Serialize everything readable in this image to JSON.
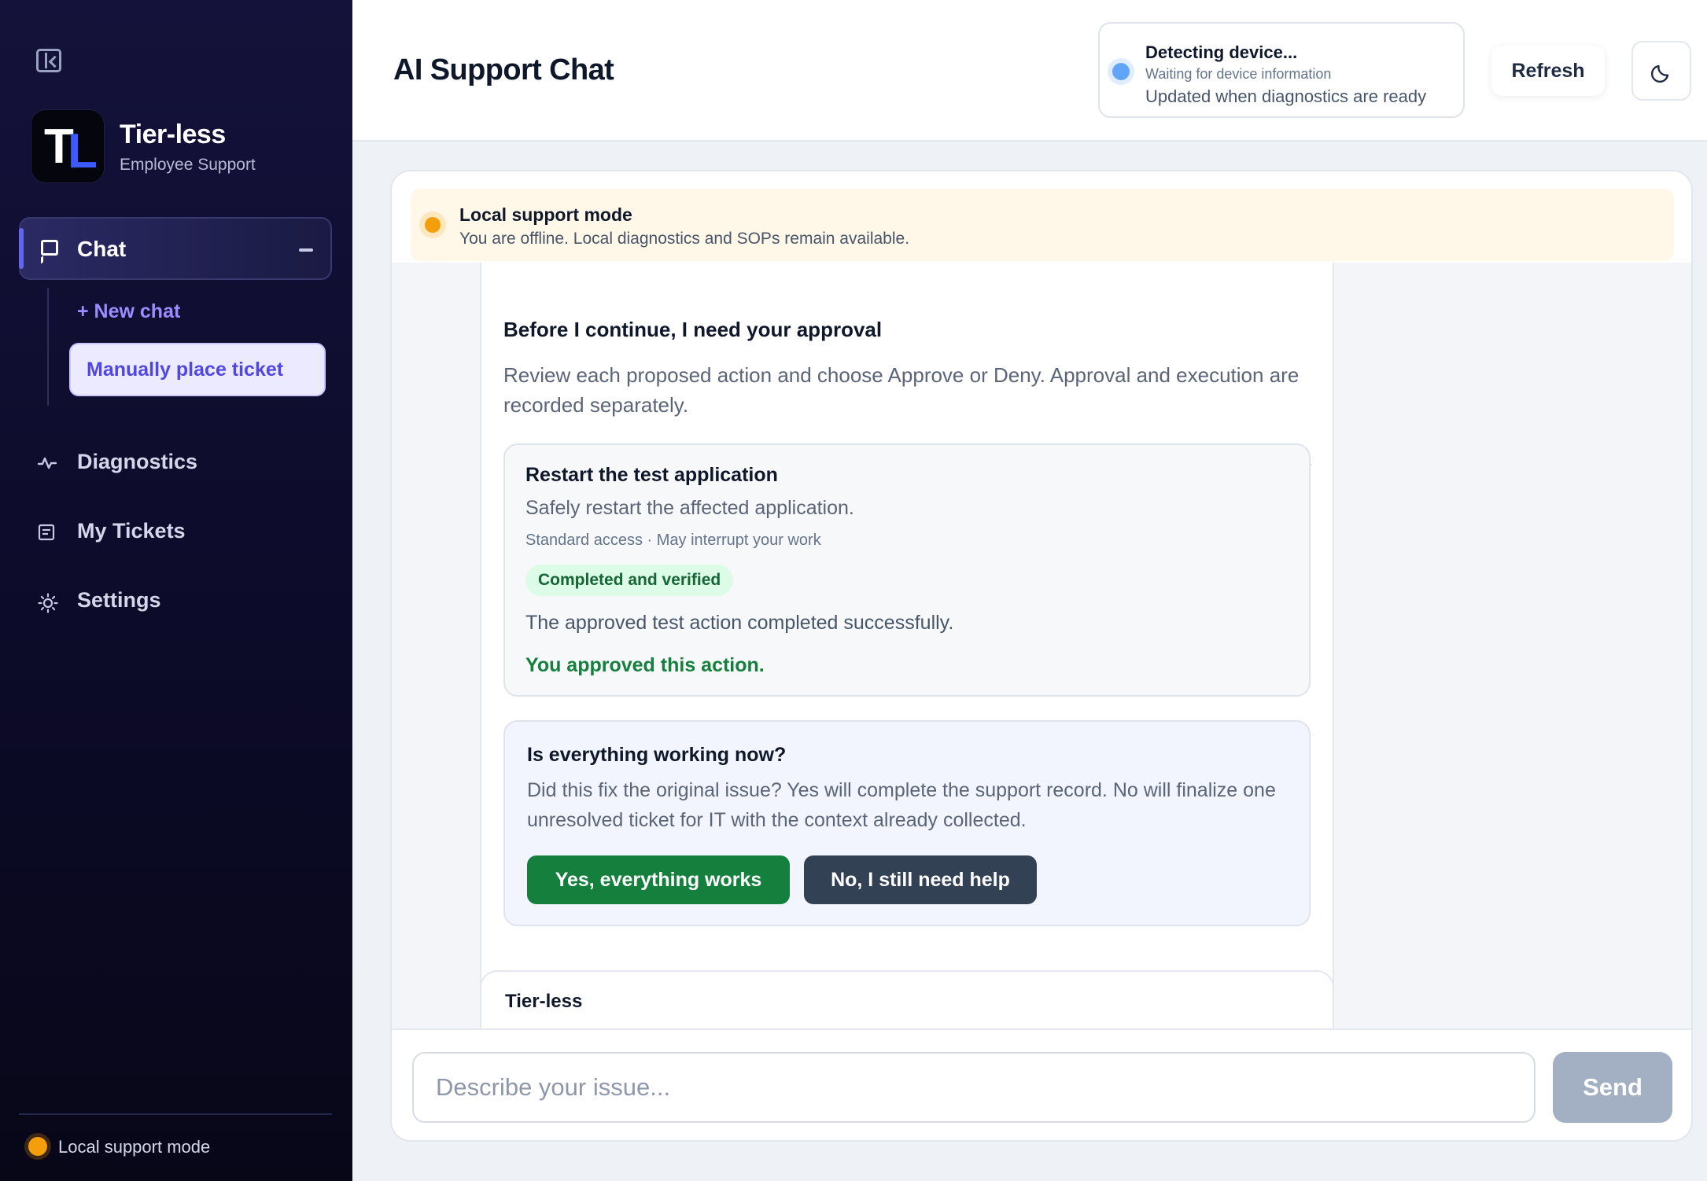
{
  "sidebar": {
    "brand": {
      "logo_letters": [
        "T",
        "L"
      ],
      "name": "Tier-less",
      "subtitle": "Employee Support"
    },
    "nav": {
      "chat": "Chat",
      "new_chat": "+ New chat",
      "manual_ticket": "Manually place ticket",
      "diagnostics": "Diagnostics",
      "my_tickets": "My Tickets",
      "settings": "Settings"
    },
    "status": "Local support mode"
  },
  "header": {
    "title": "AI Support Chat",
    "device": {
      "title": "Detecting device...",
      "subtitle": "Waiting for device information",
      "note": "Updated when diagnostics are ready"
    },
    "refresh_label": "Refresh"
  },
  "banner": {
    "title": "Local support mode",
    "text": "You are offline. Local diagnostics and SOPs remain available."
  },
  "message": {
    "approval_title": "Before I continue, I need your approval",
    "approval_text": "Review each proposed action and choose Approve or Deny. Approval and execution are recorded separately.",
    "action": {
      "title": "Restart the test application",
      "description": "Safely restart the affected application.",
      "meta": "Standard access · May interrupt your work",
      "status_badge": "Completed and verified",
      "result": "The approved test action completed successfully.",
      "approval_note": "You approved this action."
    },
    "followup": {
      "title": "Is everything working now?",
      "text": "Did this fix the original issue? Yes will complete the support record. No will finalize one unresolved ticket for IT with the context already collected.",
      "yes_label": "Yes, everything works",
      "no_label": "No, I still need help"
    }
  },
  "next_message": {
    "sender": "Tier-less"
  },
  "composer": {
    "placeholder": "Describe your issue...",
    "send_label": "Send"
  },
  "colors": {
    "accent": "#4f46e5",
    "success": "#15803d",
    "dark_button": "#334155",
    "warning": "#f59e0b",
    "info": "#60a5fa"
  }
}
